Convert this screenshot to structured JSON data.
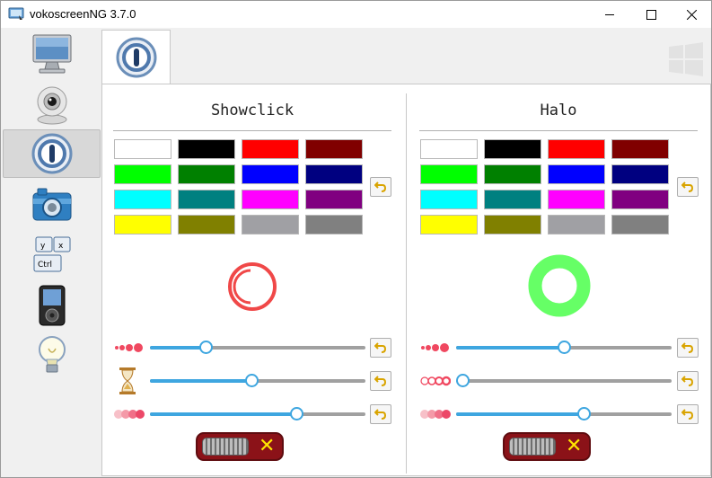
{
  "window": {
    "title": "vokoscreenNG 3.7.0"
  },
  "sidebar": {
    "items": [
      {
        "name": "screencast",
        "icon": "monitor-icon"
      },
      {
        "name": "camera",
        "icon": "webcam-icon"
      },
      {
        "name": "showclick",
        "icon": "showclick-icon",
        "active": true
      },
      {
        "name": "snapshot",
        "icon": "photo-camera-icon"
      },
      {
        "name": "hotkeys",
        "icon": "keyboard-icon"
      },
      {
        "name": "player",
        "icon": "media-player-icon"
      },
      {
        "name": "log",
        "icon": "lightbulb-icon"
      }
    ]
  },
  "tabs": [
    {
      "icon": "showclick-icon",
      "active": true
    }
  ],
  "showclick": {
    "title": "Showclick",
    "colors": [
      "#ffffff",
      "#000000",
      "#ff0000",
      "#800000",
      "#00ff00",
      "#008000",
      "#0000ff",
      "#000080",
      "#00ffff",
      "#008080",
      "#ff00ff",
      "#800080",
      "#ffff00",
      "#808000",
      "#a0a0a4",
      "#808080"
    ],
    "preview": {
      "style": "showclick-circle",
      "color": "#f04848"
    },
    "sliders": [
      {
        "icon": "size-dots-icon",
        "value": 26
      },
      {
        "icon": "hourglass-icon",
        "value": 47
      },
      {
        "icon": "opacity-dots-icon",
        "value": 68
      }
    ],
    "toggle_state": "off"
  },
  "halo": {
    "title": "Halo",
    "colors": [
      "#ffffff",
      "#000000",
      "#ff0000",
      "#800000",
      "#00ff00",
      "#008000",
      "#0000ff",
      "#000080",
      "#00ffff",
      "#008080",
      "#ff00ff",
      "#800080",
      "#ffff00",
      "#808000",
      "#a0a0a4",
      "#808080"
    ],
    "preview": {
      "style": "halo-ring",
      "color": "#66ff66"
    },
    "sliders": [
      {
        "icon": "size-dots-icon",
        "value": 50
      },
      {
        "icon": "hollow-dots-icon",
        "value": 3
      },
      {
        "icon": "opacity-dots-icon",
        "value": 59
      }
    ],
    "toggle_state": "off"
  }
}
